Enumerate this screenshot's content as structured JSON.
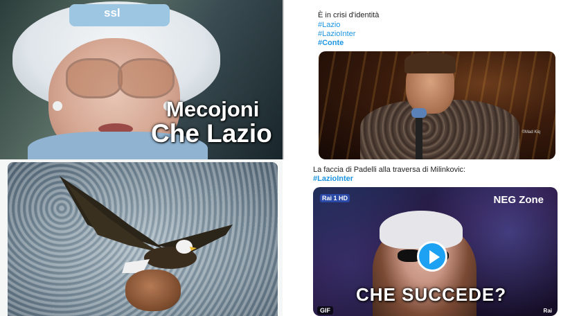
{
  "top_left_meme": {
    "hat_text": "ssl",
    "caption_line1": "Mecojoni",
    "caption_line2": "Che Lazio"
  },
  "tweet_1": {
    "text": "È in crisi d'identità",
    "hashtags": [
      "#Lazio",
      "#LazioInter",
      "#Conte"
    ],
    "image_credit": "©Mad Kiq"
  },
  "tweet_2": {
    "text": "La faccia di Padelli alla traversa di Milinkovic:",
    "hashtag": "#LazioInter",
    "video": {
      "channel_logo": "Rai 1 HD",
      "overlay_label": "NEG Zone",
      "caption": "CHE SUCCEDE?",
      "badge": "GIF",
      "watermark": "Rai"
    }
  },
  "colors": {
    "hashtag": "#1b95e0",
    "play_button": "#1da1f2"
  },
  "icons": {
    "play": "play-icon"
  }
}
